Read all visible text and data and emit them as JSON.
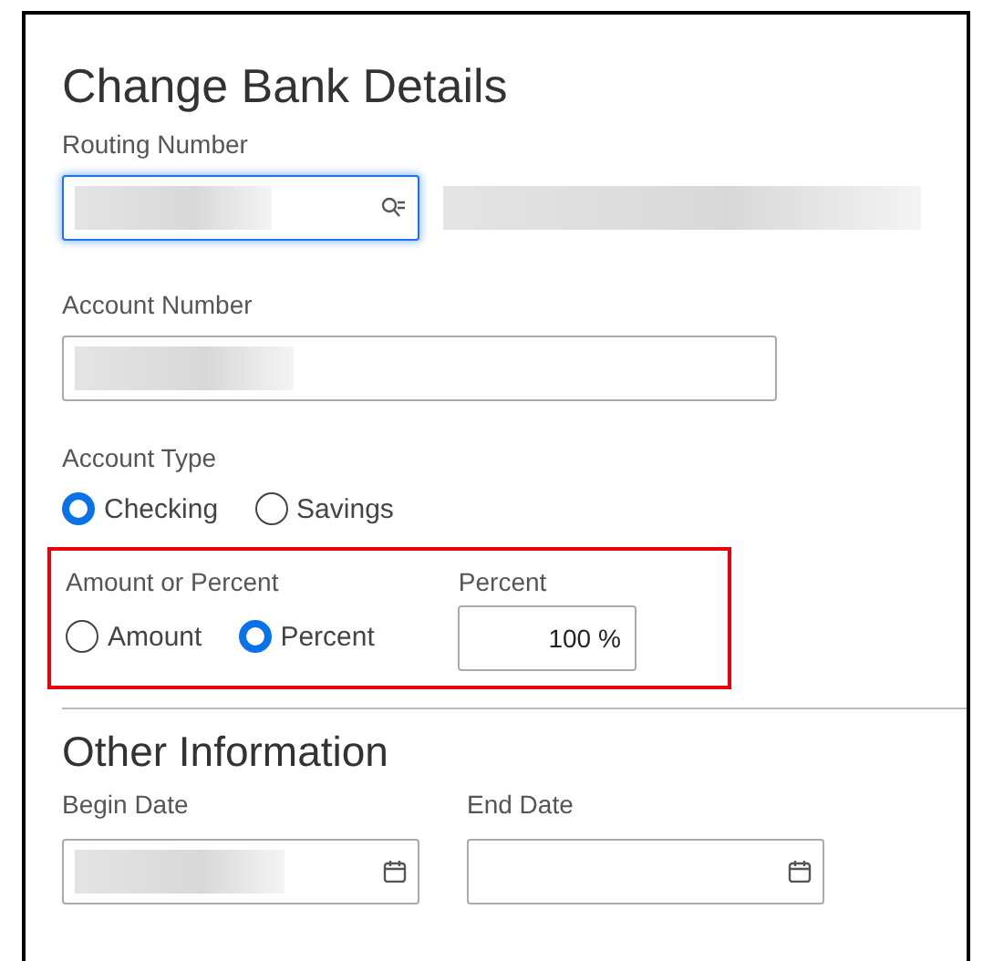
{
  "title": "Change Bank Details",
  "routing": {
    "label": "Routing Number",
    "focused": true,
    "redacted": true,
    "name_redacted": true
  },
  "account": {
    "label": "Account Number",
    "redacted": true
  },
  "account_type": {
    "label": "Account Type",
    "options": [
      {
        "label": "Checking",
        "selected": true
      },
      {
        "label": "Savings",
        "selected": false
      }
    ]
  },
  "amount_section": {
    "highlighted": true,
    "label": "Amount or Percent",
    "options": [
      {
        "label": "Amount",
        "selected": false
      },
      {
        "label": "Percent",
        "selected": true
      }
    ],
    "percent": {
      "label": "Percent",
      "value": "100 %"
    }
  },
  "other": {
    "title": "Other Information",
    "dates": [
      {
        "label": "Begin Date",
        "redacted": true
      },
      {
        "label": "End Date",
        "redacted": false
      }
    ]
  }
}
